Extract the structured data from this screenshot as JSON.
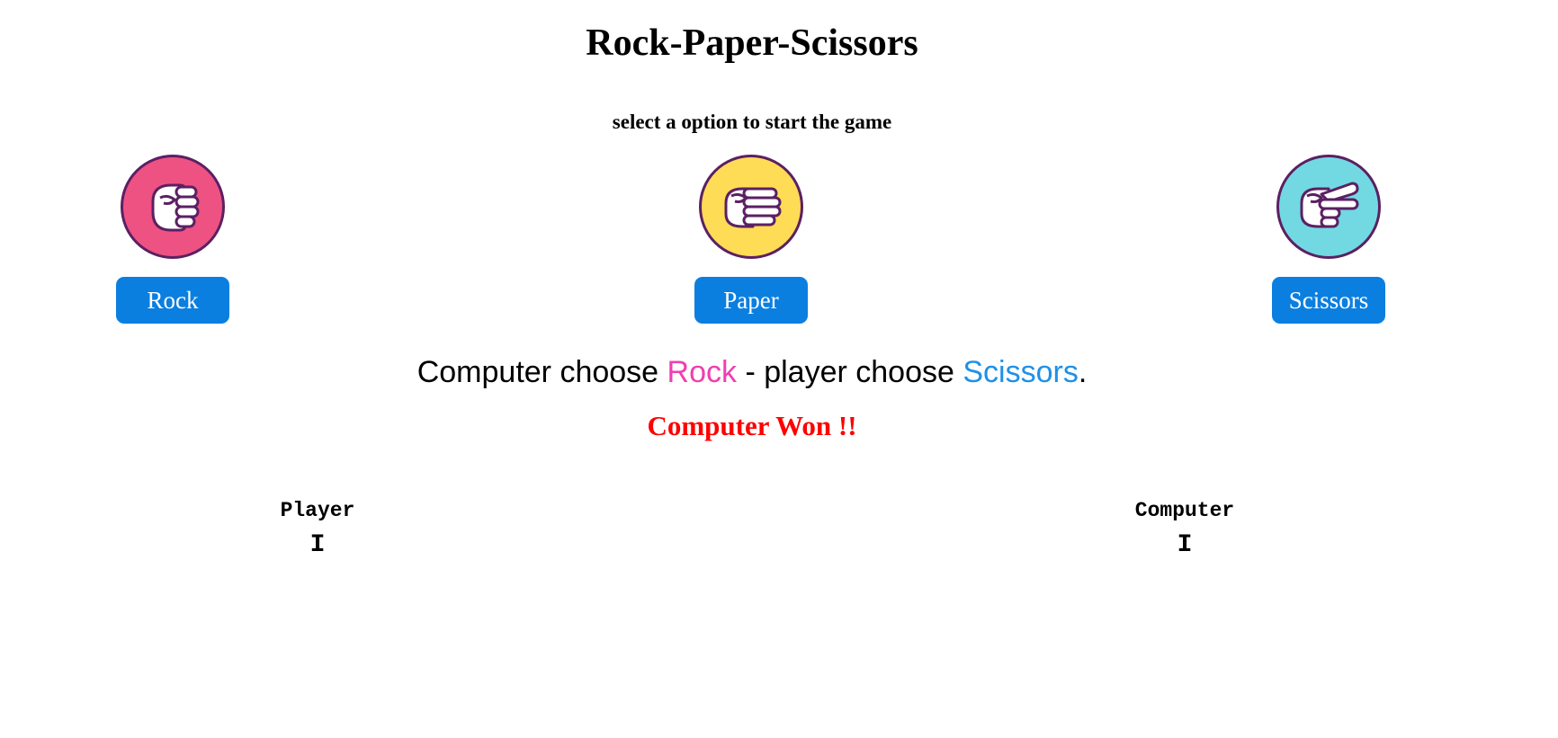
{
  "header": {
    "title": "Rock-Paper-Scissors",
    "subtitle": "select a option to start the game"
  },
  "options": [
    {
      "label": "Rock",
      "icon": "rock-fist-icon",
      "color": "#ee5282"
    },
    {
      "label": "Paper",
      "icon": "paper-hand-icon",
      "color": "#ffdc55"
    },
    {
      "label": "Scissors",
      "icon": "scissors-hand-icon",
      "color": "#72d9e2"
    }
  ],
  "result": {
    "prefix": "Computer choose ",
    "computer_choice": "Rock",
    "middle": " - player choose ",
    "player_choice": "Scissors",
    "suffix": ".",
    "winner_text": "Computer Won !!",
    "computer_choice_color": "#f03fb0",
    "player_choice_color": "#1e90e8",
    "winner_color": "#ff0000"
  },
  "scoreboard": {
    "player_label": "Player",
    "player_score": "I",
    "computer_label": "Computer",
    "computer_score": "I"
  },
  "colors": {
    "button": "#0b7fe0",
    "icon_outline": "#5b2063"
  }
}
